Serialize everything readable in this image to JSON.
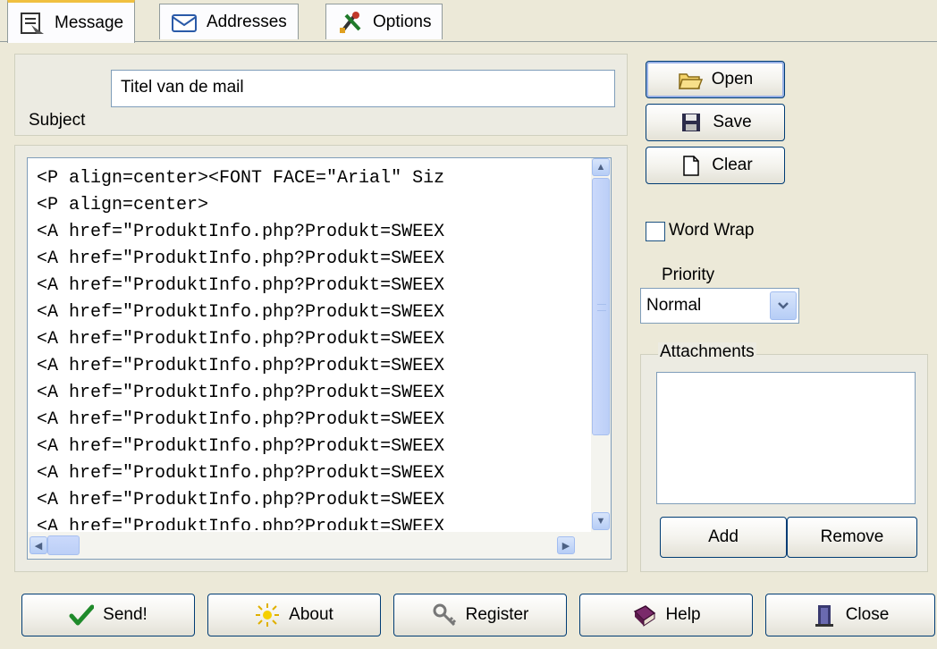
{
  "tabs": [
    {
      "label": "Message",
      "icon": "message-icon",
      "active": true
    },
    {
      "label": "Addresses",
      "icon": "envelope-icon",
      "active": false
    },
    {
      "label": "Options",
      "icon": "tools-icon",
      "active": false
    }
  ],
  "subject": {
    "label": "Subject",
    "value": "Titel van de mail"
  },
  "editor": {
    "lines": [
      "<P align=center><FONT FACE=\"Arial\" Siz",
      "<P align=center>",
      "<A href=\"ProduktInfo.php?Produkt=SWEEX",
      "<A href=\"ProduktInfo.php?Produkt=SWEEX",
      "<A href=\"ProduktInfo.php?Produkt=SWEEX",
      "<A href=\"ProduktInfo.php?Produkt=SWEEX",
      "<A href=\"ProduktInfo.php?Produkt=SWEEX",
      "<A href=\"ProduktInfo.php?Produkt=SWEEX",
      "<A href=\"ProduktInfo.php?Produkt=SWEEX",
      "<A href=\"ProduktInfo.php?Produkt=SWEEX",
      "<A href=\"ProduktInfo.php?Produkt=SWEEX",
      "<A href=\"ProduktInfo.php?Produkt=SWEEX",
      "<A href=\"ProduktInfo.php?Produkt=SWEEX",
      "<A href=\"ProduktInfo.php?Produkt=SWEEX"
    ]
  },
  "side": {
    "open_label": "Open",
    "save_label": "Save",
    "clear_label": "Clear",
    "wordwrap_label": "Word Wrap",
    "wordwrap_checked": false,
    "priority_label": "Priority",
    "priority_value": "Normal",
    "attachments_label": "Attachments",
    "add_label": "Add",
    "remove_label": "Remove"
  },
  "bottom": {
    "send_label": "Send!",
    "about_label": "About",
    "register_label": "Register",
    "help_label": "Help",
    "close_label": "Close"
  },
  "colors": {
    "background": "#ece9d8",
    "button_border": "#003c74",
    "tab_highlight": "#f0c040"
  }
}
